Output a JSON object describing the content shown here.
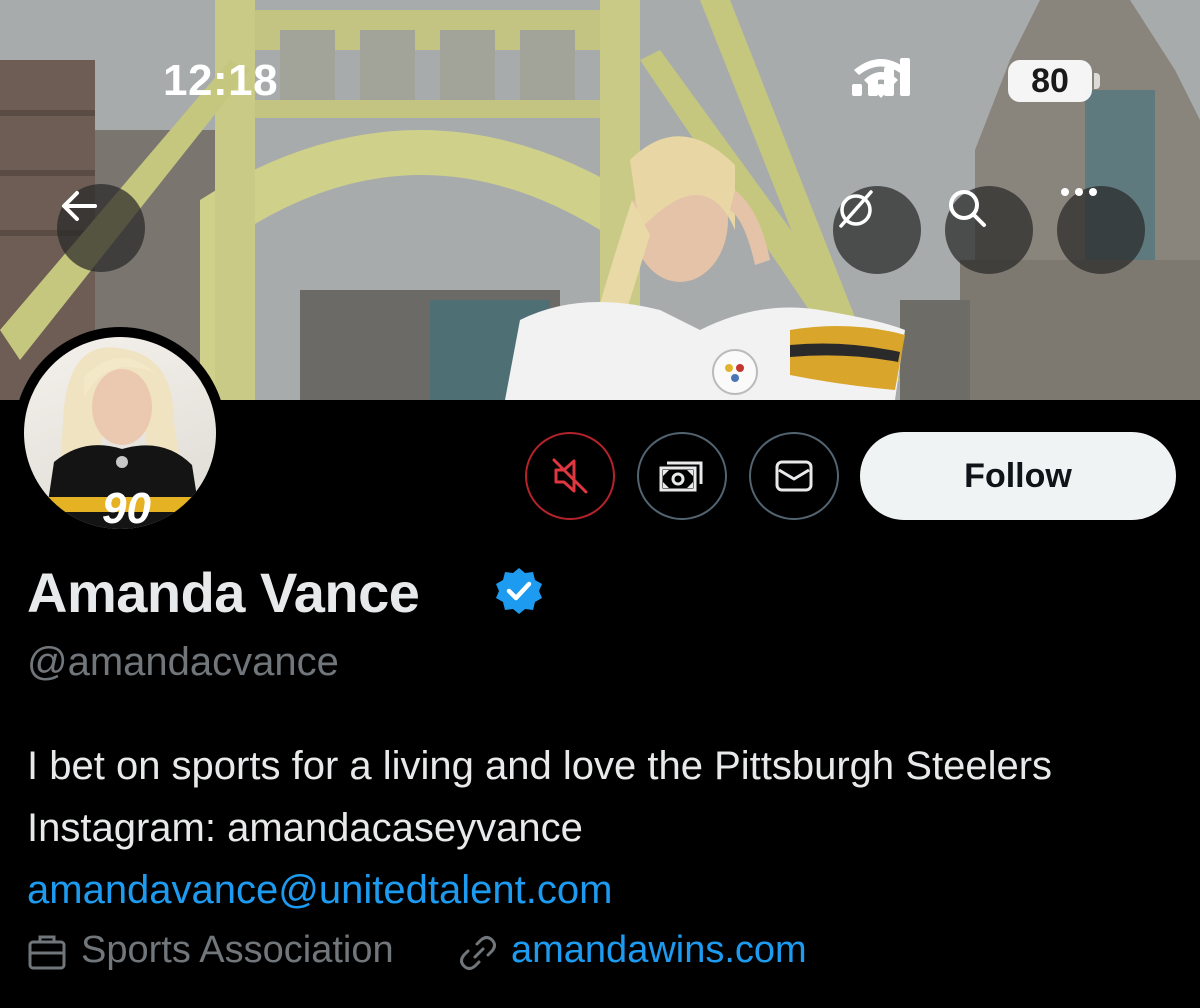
{
  "status_bar": {
    "time": "12:18",
    "battery": "80"
  },
  "banner": {
    "buttons": {
      "back_icon": "arrow-left-icon",
      "grok_icon": "grok-slash-icon",
      "search_icon": "search-icon",
      "more_icon": "more-horizontal-icon"
    }
  },
  "actions": {
    "mute_icon": "muted-speaker-icon",
    "subscribe_icon": "money-icon",
    "message_icon": "envelope-icon",
    "follow_label": "Follow"
  },
  "profile": {
    "display_name": "Amanda Vance",
    "verified": true,
    "handle": "@amandacvance",
    "bio_lines": [
      "I bet on sports for a living and love the Pittsburgh Steelers",
      "Instagram: amandacaseyvance"
    ],
    "bio_email": "amandavance@unitedtalent.com",
    "category": "Sports Association",
    "website": "amandawins.com"
  },
  "colors": {
    "accent_blue": "#1d9bf0",
    "muted_red": "#b4232a",
    "secondary_text": "#71767b",
    "follow_bg": "#eff3f4"
  }
}
